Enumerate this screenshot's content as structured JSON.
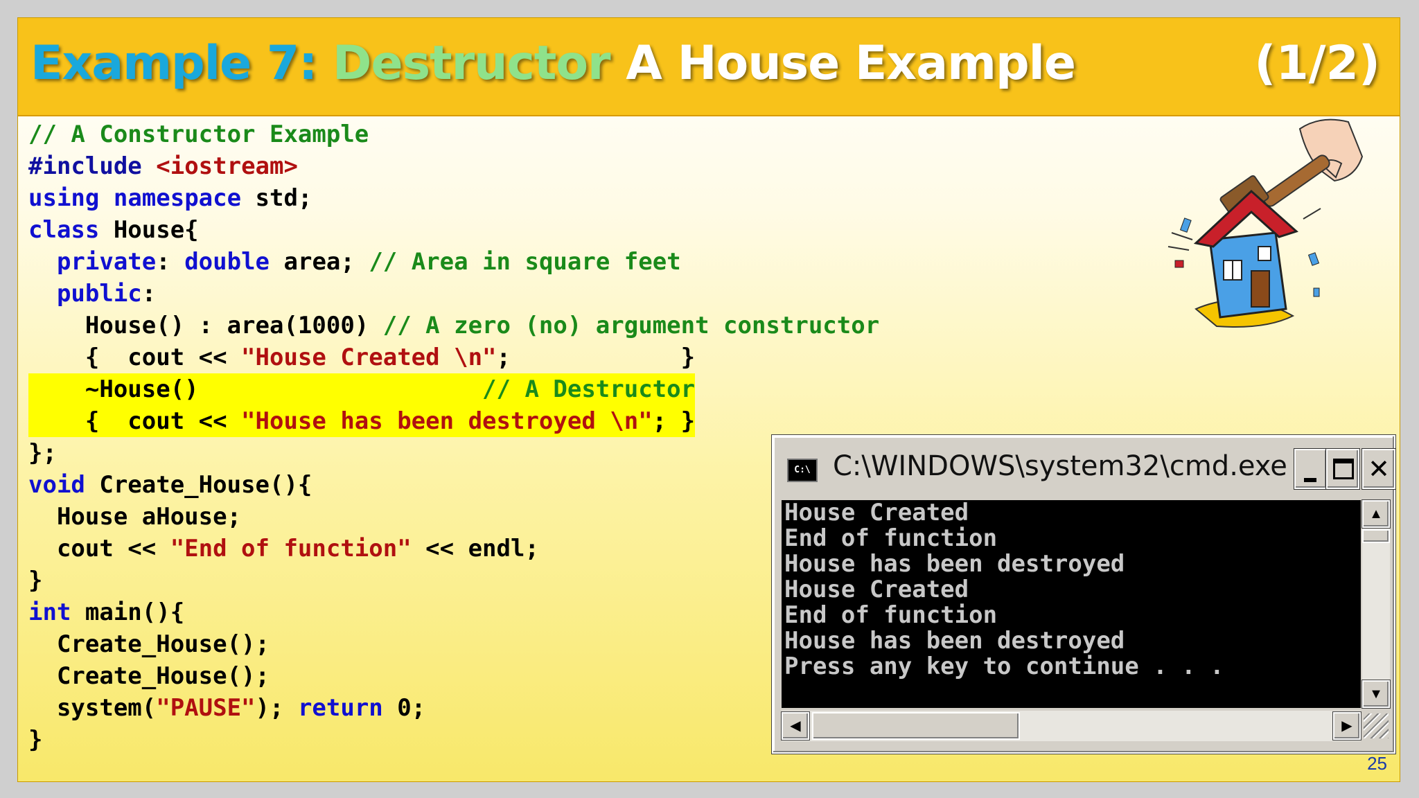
{
  "title": {
    "part1": "Example 7:",
    "part2": "Destructor",
    "part3": "A House Example",
    "page_fraction": "(1/2)"
  },
  "code_lines": [
    "// A Constructor Example",
    "#include <iostream>",
    "using namespace std;",
    "class House{",
    "  private: double area; // Area in square feet",
    "  public:",
    "    House() : area(1000) // A zero (no) argument constructor",
    "    {  cout << \"House Created \\n\";            }",
    "    ~House()                    // A Destructor",
    "    {  cout << \"House has been destroyed \\n\"; }",
    "};",
    "void Create_House(){",
    "  House aHouse;",
    "  cout << \"End of function\" << endl;",
    "}",
    "int main(){",
    "  Create_House();",
    "  Create_House();",
    "  system(\"PAUSE\"); return 0;",
    "}"
  ],
  "highlighted_lines": [
    8,
    9
  ],
  "illustration": {
    "label": "Destructor",
    "icon": "hammer-house-icon"
  },
  "cmd_window": {
    "title": "C:\\WINDOWS\\system32\\cmd.exe",
    "icon_text": "C:\\",
    "output": [
      "House Created",
      "End of function",
      "House has been destroyed",
      "House Created",
      "End of function",
      "House has been destroyed",
      "Press any key to continue . . ."
    ]
  },
  "slide_number": "25",
  "colors": {
    "title_bar": "#f8c21a",
    "title_part1": "#1aa8dc",
    "title_part2": "#8fe28b",
    "highlight": "#ffff00",
    "comment": "#1a8a1a",
    "keyword": "#1010d0",
    "string": "#b01010"
  }
}
